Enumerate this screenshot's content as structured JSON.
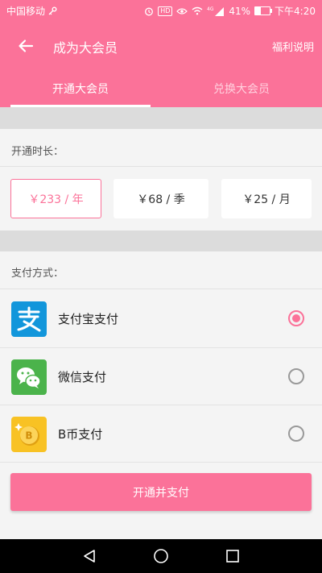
{
  "status": {
    "carrier": "中国移动",
    "hd": "HD",
    "network": "4G",
    "battery": "41%",
    "battery_level": 0.41,
    "time": "下午4:20"
  },
  "header": {
    "title": "成为大会员",
    "action": "福利说明"
  },
  "tabs": [
    {
      "label": "开通大会员",
      "active": true
    },
    {
      "label": "兑换大会员",
      "active": false
    }
  ],
  "duration": {
    "label": "开通时长：",
    "options": [
      {
        "label": "￥233 / 年",
        "selected": true
      },
      {
        "label": "￥68 / 季",
        "selected": false
      },
      {
        "label": "￥25 / 月",
        "selected": false
      }
    ]
  },
  "payment": {
    "label": "支付方式：",
    "methods": [
      {
        "label": "支付宝支付",
        "icon": "alipay-icon",
        "selected": true
      },
      {
        "label": "微信支付",
        "icon": "wechat-icon",
        "selected": false
      },
      {
        "label": "B币支付",
        "icon": "bcoin-icon",
        "selected": false
      }
    ]
  },
  "submit_label": "开通并支付",
  "colors": {
    "accent": "#fb7299",
    "alipay": "#1296db",
    "wechat": "#4bb34b",
    "bcoin": "#f8c224"
  }
}
